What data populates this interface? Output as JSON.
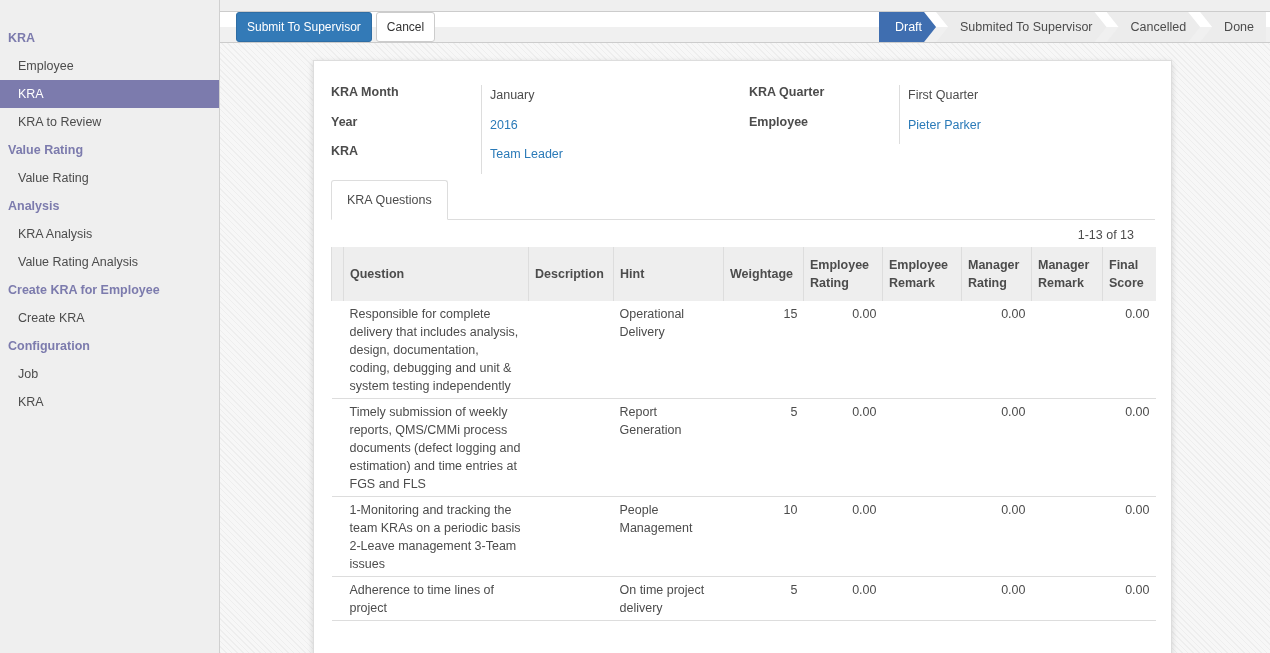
{
  "sidebar": {
    "sections": [
      {
        "title": "KRA",
        "items": [
          {
            "label": "Employee",
            "selected": false
          },
          {
            "label": "KRA",
            "selected": true
          },
          {
            "label": "KRA to Review",
            "selected": false
          }
        ]
      },
      {
        "title": "Value Rating",
        "items": [
          {
            "label": "Value Rating",
            "selected": false
          }
        ]
      },
      {
        "title": "Analysis",
        "items": [
          {
            "label": "KRA Analysis",
            "selected": false
          },
          {
            "label": "Value Rating Analysis",
            "selected": false
          }
        ]
      },
      {
        "title": "Create KRA for Employee",
        "items": [
          {
            "label": "Create KRA",
            "selected": false
          }
        ]
      },
      {
        "title": "Configuration",
        "items": [
          {
            "label": "Job",
            "selected": false
          },
          {
            "label": "KRA",
            "selected": false
          }
        ]
      }
    ]
  },
  "toolbar": {
    "buttons": [
      {
        "label": "Submit To Supervisor",
        "kind": "primary"
      },
      {
        "label": "Cancel",
        "kind": "default"
      }
    ]
  },
  "statusbar": [
    {
      "label": "Draft",
      "selected": true
    },
    {
      "label": "Submited To Supervisor",
      "selected": false
    },
    {
      "label": "Cancelled",
      "selected": false
    },
    {
      "label": "Done",
      "selected": false
    }
  ],
  "form": {
    "left": [
      {
        "label": "KRA Month",
        "value": "January",
        "link": false
      },
      {
        "label": "Year",
        "value": "2016",
        "link": true
      },
      {
        "label": "KRA",
        "value": "Team Leader",
        "link": true
      }
    ],
    "right": [
      {
        "label": "KRA Quarter",
        "value": "First Quarter",
        "link": false
      },
      {
        "label": "Employee",
        "value": "Pieter Parker",
        "link": true
      }
    ]
  },
  "tabs": [
    {
      "label": "KRA Questions",
      "selected": true
    }
  ],
  "pager": "1-13 of 13",
  "table": {
    "columns": [
      "Question",
      "Description",
      "Hint",
      "Weightage",
      "Employee Rating",
      "Employee Remark",
      "Manager Rating",
      "Manager Remark",
      "Final Score"
    ],
    "rows": [
      [
        "Responsible for complete delivery that includes analysis, design, documentation, coding, debugging and unit & system testing independently",
        "",
        "Operational Delivery",
        "15",
        "0.00",
        "",
        "0.00",
        "",
        "0.00"
      ],
      [
        "Timely submission of weekly reports, QMS/CMMi process documents (defect logging and estimation) and time entries at FGS and FLS",
        "",
        "Report Generation",
        "5",
        "0.00",
        "",
        "0.00",
        "",
        "0.00"
      ],
      [
        "1-Monitoring and tracking the team KRAs on a periodic basis 2-Leave management 3-Team issues",
        "",
        "People Management",
        "10",
        "0.00",
        "",
        "0.00",
        "",
        "0.00"
      ],
      [
        "Adherence to time lines of project",
        "",
        "On time project delivery",
        "5",
        "0.00",
        "",
        "0.00",
        "",
        "0.00"
      ]
    ]
  }
}
